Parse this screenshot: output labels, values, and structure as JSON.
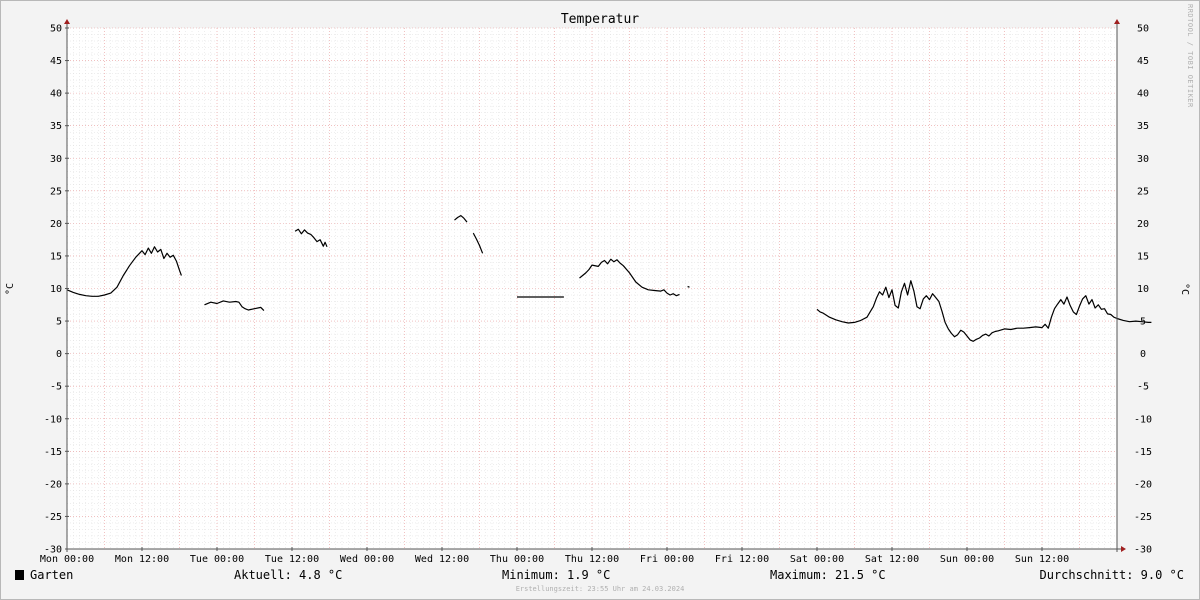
{
  "chart_data": {
    "type": "line",
    "title": "Temperatur",
    "ylabel": "°C",
    "ylim": [
      -30,
      50
    ],
    "y_ticks": [
      50,
      45,
      40,
      35,
      30,
      25,
      20,
      15,
      10,
      5,
      0,
      -5,
      -10,
      -15,
      -20,
      -25,
      -30
    ],
    "y_tick_labels": [
      "50",
      "45",
      "40",
      "35",
      "30",
      "25",
      "20",
      "15",
      "10",
      "5",
      "0",
      "-5",
      "-10",
      "-15",
      "-20",
      "-25",
      "-30"
    ],
    "x_unit": "hours since Mon 00:00",
    "xlim": [
      0,
      168
    ],
    "x_ticks": [
      0,
      12,
      24,
      36,
      48,
      60,
      72,
      84,
      96,
      108,
      120,
      132,
      144,
      156
    ],
    "x_tick_labels": [
      "Mon 00:00",
      "Mon 12:00",
      "Tue 00:00",
      "Tue 12:00",
      "Wed 00:00",
      "Wed 12:00",
      "Thu 00:00",
      "Thu 12:00",
      "Fri 00:00",
      "Fri 12:00",
      "Sat 00:00",
      "Sat 12:00",
      "Sun 00:00",
      "Sun 12:00"
    ],
    "grid": true,
    "legend": "bottom-left",
    "series": [
      {
        "name": "Garten",
        "color": "#000000",
        "segments": [
          [
            [
              0,
              9.8
            ],
            [
              1,
              9.4
            ],
            [
              2,
              9.1
            ],
            [
              3,
              8.9
            ],
            [
              4,
              8.8
            ],
            [
              5,
              8.8
            ],
            [
              6,
              9.0
            ],
            [
              7,
              9.3
            ],
            [
              8,
              10.2
            ],
            [
              9,
              12.0
            ],
            [
              10,
              13.5
            ],
            [
              11,
              14.8
            ],
            [
              12,
              15.8
            ],
            [
              12.5,
              15.2
            ],
            [
              13,
              16.2
            ],
            [
              13.5,
              15.4
            ],
            [
              14,
              16.4
            ],
            [
              14.5,
              15.6
            ],
            [
              15,
              16.0
            ],
            [
              15.5,
              14.6
            ],
            [
              16,
              15.4
            ],
            [
              16.5,
              14.8
            ],
            [
              17,
              15.1
            ],
            [
              17.5,
              14.2
            ],
            [
              18,
              12.8
            ],
            [
              18.3,
              12.0
            ]
          ],
          [
            [
              22,
              7.5
            ],
            [
              23,
              7.9
            ],
            [
              24,
              7.7
            ],
            [
              25,
              8.1
            ],
            [
              26,
              7.9
            ],
            [
              27,
              8.0
            ],
            [
              27.5,
              7.9
            ],
            [
              28,
              7.2
            ],
            [
              28.5,
              6.9
            ],
            [
              29,
              6.7
            ],
            [
              30,
              6.9
            ],
            [
              31,
              7.1
            ],
            [
              31.5,
              6.6
            ]
          ],
          [
            [
              36.5,
              18.8
            ],
            [
              37,
              19.1
            ],
            [
              37.5,
              18.4
            ],
            [
              38,
              19.0
            ],
            [
              38.5,
              18.5
            ],
            [
              39,
              18.3
            ],
            [
              39.5,
              17.8
            ],
            [
              40,
              17.2
            ],
            [
              40.5,
              17.5
            ],
            [
              41,
              16.5
            ],
            [
              41.3,
              17.1
            ],
            [
              41.6,
              16.4
            ]
          ],
          [
            [
              62,
              20.5
            ],
            [
              62.5,
              20.9
            ],
            [
              63,
              21.2
            ],
            [
              63.5,
              20.8
            ],
            [
              64,
              20.2
            ]
          ],
          [
            [
              65,
              18.5
            ],
            [
              65.5,
              17.6
            ],
            [
              66,
              16.6
            ],
            [
              66.5,
              15.4
            ]
          ],
          [
            [
              72,
              8.7
            ],
            [
              79.5,
              8.7
            ]
          ],
          [
            [
              82,
              11.6
            ],
            [
              82.5,
              12.0
            ],
            [
              83,
              12.4
            ],
            [
              83.5,
              12.9
            ],
            [
              84,
              13.6
            ],
            [
              85,
              13.4
            ],
            [
              85.5,
              14.0
            ],
            [
              86,
              14.3
            ],
            [
              86.5,
              13.8
            ],
            [
              87,
              14.5
            ],
            [
              87.5,
              14.1
            ],
            [
              88,
              14.4
            ],
            [
              88.5,
              13.9
            ],
            [
              89,
              13.5
            ],
            [
              90,
              12.4
            ],
            [
              91,
              11.0
            ],
            [
              92,
              10.2
            ],
            [
              93,
              9.8
            ],
            [
              94,
              9.7
            ],
            [
              95,
              9.6
            ],
            [
              95.5,
              9.8
            ],
            [
              96,
              9.3
            ],
            [
              96.5,
              9.0
            ],
            [
              97,
              9.2
            ],
            [
              97.5,
              8.9
            ],
            [
              98,
              9.1
            ]
          ],
          [
            [
              99.3,
              10.3
            ],
            [
              99.6,
              10.2
            ]
          ],
          [
            [
              120,
              6.8
            ],
            [
              120.5,
              6.4
            ],
            [
              121,
              6.2
            ],
            [
              122,
              5.6
            ],
            [
              123,
              5.2
            ],
            [
              124,
              4.9
            ],
            [
              125,
              4.7
            ],
            [
              126,
              4.8
            ],
            [
              127,
              5.1
            ],
            [
              128,
              5.6
            ],
            [
              128.5,
              6.4
            ],
            [
              129,
              7.2
            ],
            [
              129.5,
              8.5
            ],
            [
              130,
              9.5
            ],
            [
              130.5,
              9.0
            ],
            [
              131,
              10.2
            ],
            [
              131.5,
              8.6
            ],
            [
              132,
              9.8
            ],
            [
              132.5,
              7.4
            ],
            [
              133,
              7.0
            ],
            [
              133.5,
              9.5
            ],
            [
              134,
              10.8
            ],
            [
              134.5,
              9.0
            ],
            [
              135,
              11.2
            ],
            [
              135.5,
              9.6
            ],
            [
              136,
              7.2
            ],
            [
              136.5,
              6.9
            ],
            [
              137,
              8.4
            ],
            [
              137.5,
              8.9
            ],
            [
              138,
              8.3
            ],
            [
              138.5,
              9.2
            ],
            [
              139,
              8.6
            ],
            [
              139.5,
              8.0
            ],
            [
              140,
              6.5
            ],
            [
              140.5,
              4.8
            ],
            [
              141,
              3.8
            ],
            [
              141.5,
              3.1
            ],
            [
              142,
              2.6
            ],
            [
              142.5,
              2.9
            ],
            [
              143,
              3.6
            ],
            [
              143.5,
              3.3
            ],
            [
              144,
              2.7
            ],
            [
              144.5,
              2.1
            ],
            [
              145,
              1.9
            ],
            [
              145.5,
              2.2
            ],
            [
              146,
              2.4
            ],
            [
              146.5,
              2.8
            ],
            [
              147,
              3.0
            ],
            [
              147.5,
              2.7
            ],
            [
              148,
              3.2
            ],
            [
              148.5,
              3.4
            ],
            [
              149,
              3.5
            ],
            [
              150,
              3.8
            ],
            [
              151,
              3.7
            ],
            [
              152,
              3.9
            ],
            [
              153,
              3.9
            ],
            [
              154,
              4.0
            ],
            [
              155,
              4.1
            ],
            [
              156,
              4.0
            ],
            [
              156.5,
              4.5
            ],
            [
              157,
              3.9
            ],
            [
              157.5,
              5.6
            ],
            [
              158,
              6.9
            ],
            [
              158.5,
              7.6
            ],
            [
              159,
              8.3
            ],
            [
              159.5,
              7.6
            ],
            [
              160,
              8.7
            ],
            [
              160.5,
              7.4
            ],
            [
              161,
              6.4
            ],
            [
              161.5,
              6.0
            ],
            [
              162,
              7.3
            ],
            [
              162.5,
              8.4
            ],
            [
              163,
              8.9
            ],
            [
              163.5,
              7.6
            ],
            [
              164,
              8.3
            ],
            [
              164.5,
              7.0
            ],
            [
              165,
              7.5
            ],
            [
              165.5,
              6.8
            ],
            [
              166,
              6.9
            ],
            [
              166.5,
              6.1
            ],
            [
              167,
              6.0
            ],
            [
              167.5,
              5.6
            ],
            [
              168,
              5.4
            ],
            [
              169,
              5.1
            ],
            [
              170,
              4.9
            ],
            [
              171,
              5.0
            ],
            [
              172,
              4.9
            ],
            [
              173,
              4.8
            ],
            [
              173.5,
              4.8
            ]
          ]
        ]
      }
    ]
  },
  "watermark": "RRDTOOL / TOBI OETIKER",
  "footer": {
    "legend_label": "Garten",
    "current": "Aktuell: 4.8 °C",
    "minimum": "Minimum: 1.9 °C",
    "maximum": "Maximum: 21.5 °C",
    "average": "Durchschnitt: 9.0 °C",
    "created": "Erstellungszeit: 23:55 Uhr am 24.03.2024"
  }
}
